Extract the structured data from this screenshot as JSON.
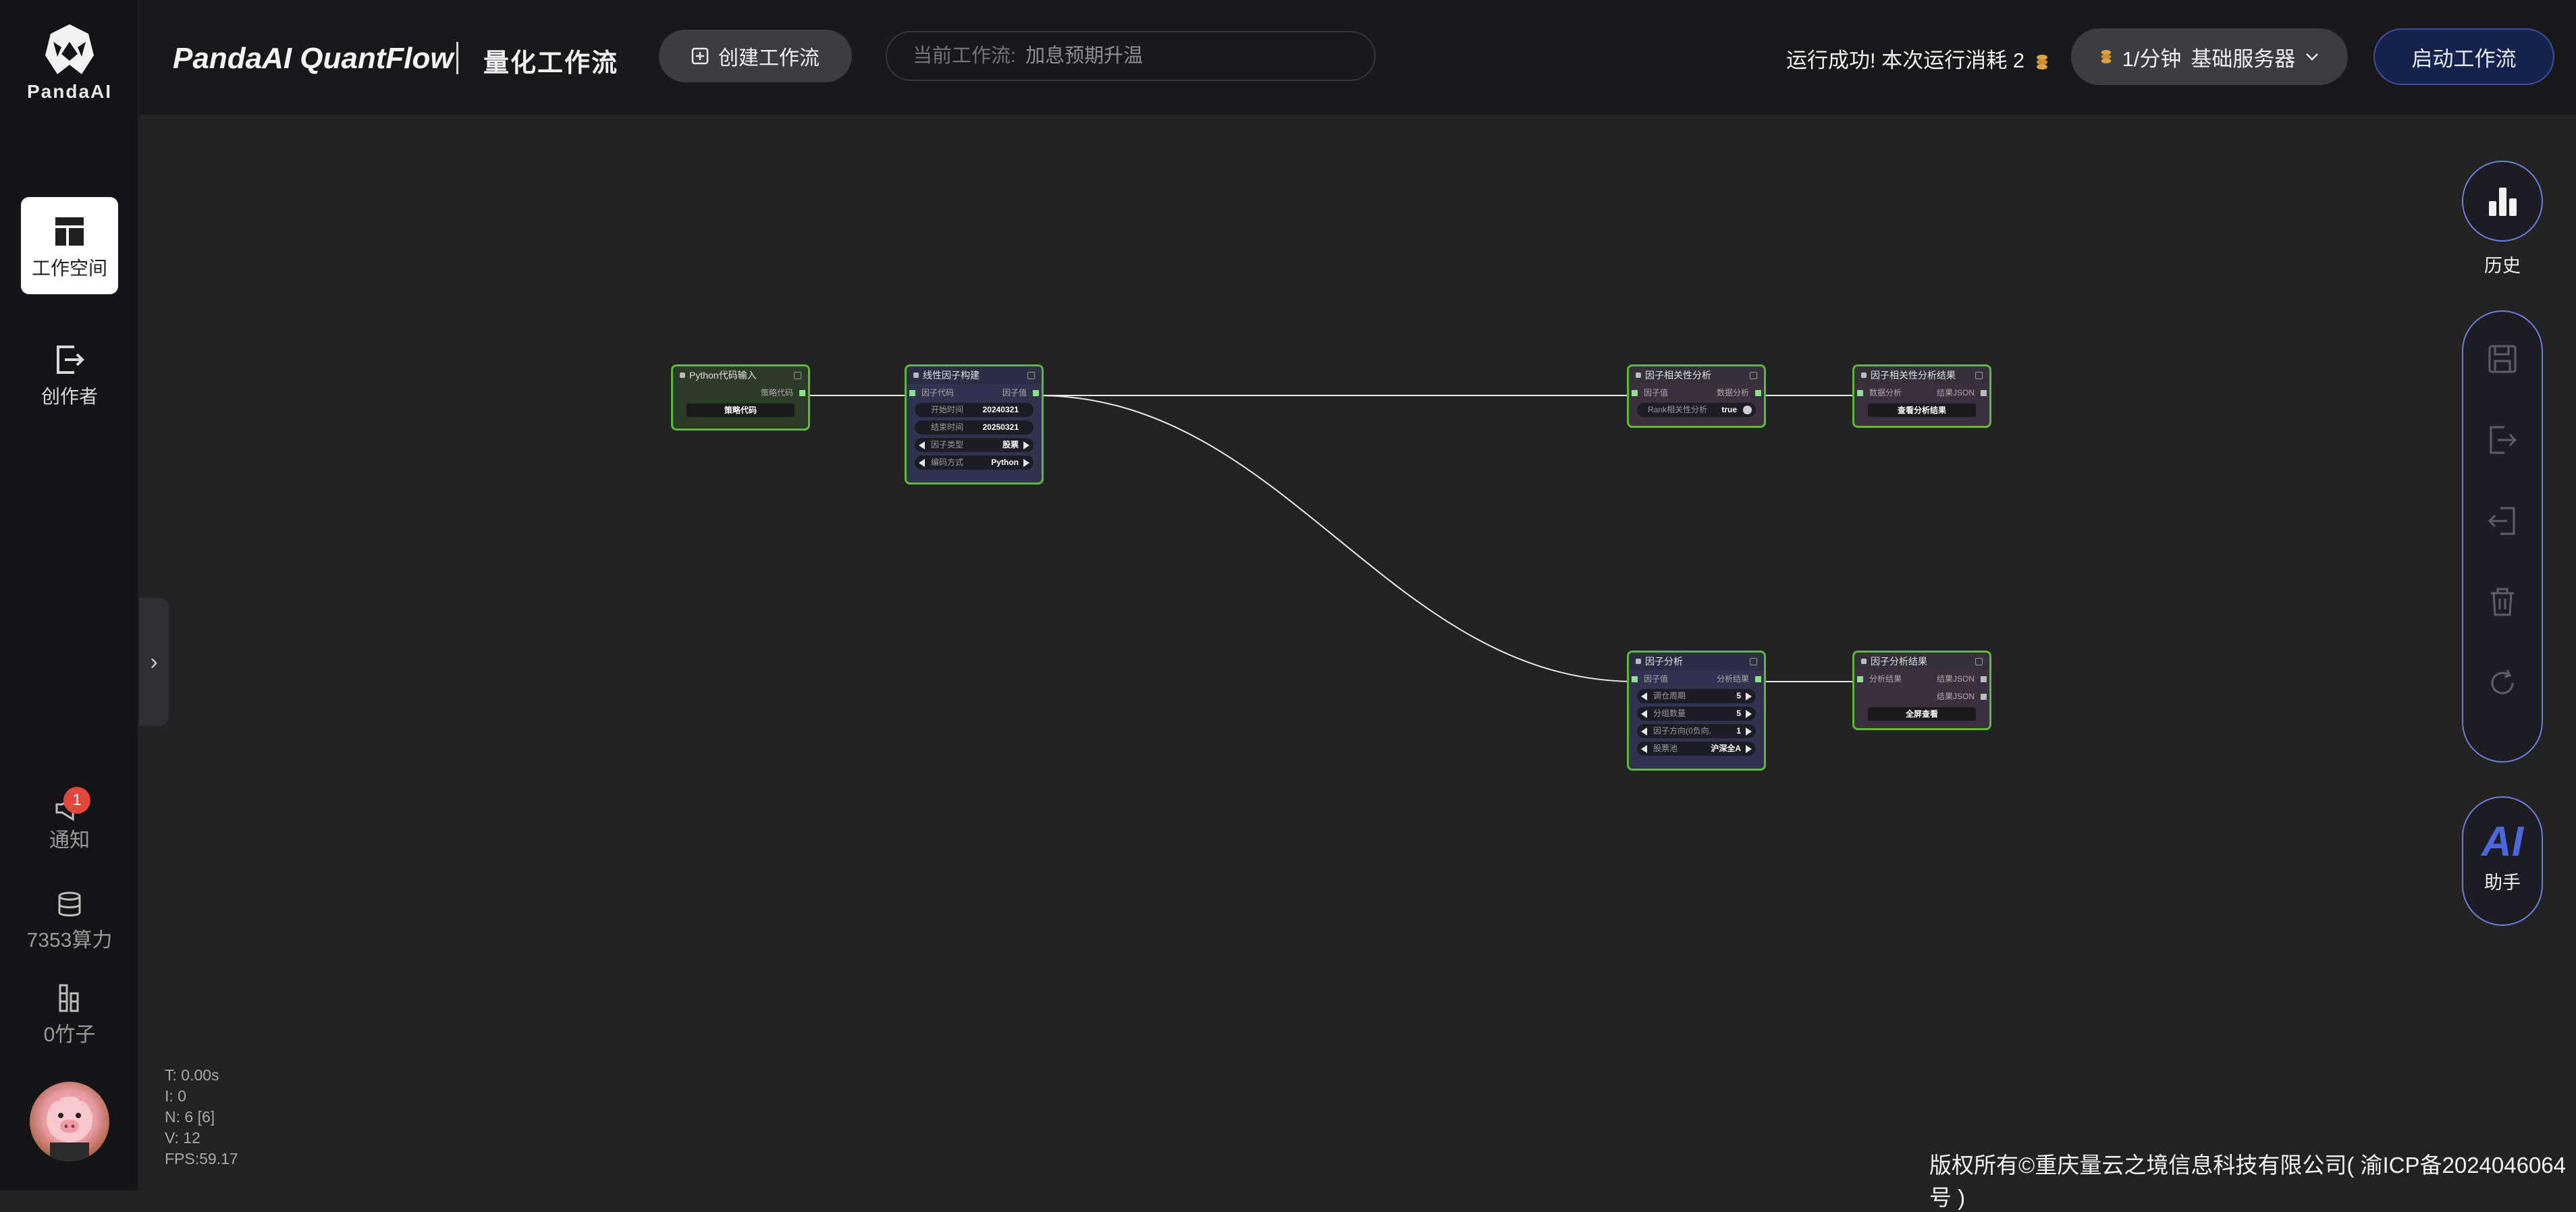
{
  "app": {
    "logo_text": "PandaAI",
    "brand": "PandaAI QuantFlow",
    "subtitle": "量化工作流"
  },
  "header": {
    "create_button": "创建工作流",
    "current_flow_label": "当前工作流:",
    "current_flow_value": "加息预期升温",
    "run_status": "运行成功!  本次运行消耗 2",
    "speed": "1/分钟",
    "server": "基础服务器",
    "start_button": "启动工作流"
  },
  "sidebar": {
    "workspace": "工作空间",
    "creator": "创作者",
    "notify": "通知",
    "notify_count": "1",
    "compute": "7353算力",
    "bamboo": "0竹子"
  },
  "stats": {
    "t": "T: 0.00s",
    "i": "I: 0",
    "n": "N: 6 [6]",
    "v": "V: 12",
    "fps": "FPS:59.17"
  },
  "copyright": "版权所有©重庆量云之境信息科技有限公司( 渝ICP备2024046064号 )",
  "right_panel": {
    "history": "历史",
    "ai_text": "AI",
    "assistant": "助手"
  },
  "nodes": {
    "python_input": {
      "title": "Python代码输入",
      "out_label": "策略代码",
      "button": "策略代码"
    },
    "factor_build": {
      "title": "线性因子构建",
      "in_label": "因子代码",
      "out_label": "因子值",
      "start_label": "开始时间",
      "start_value": "20240321",
      "end_label": "结束时间",
      "end_value": "20250321",
      "type_label": "因子类型",
      "type_value": "股票",
      "method_label": "编码方式",
      "method_value": "Python"
    },
    "corr_analysis": {
      "title": "因子相关性分析",
      "in_label": "因子值",
      "out_label": "数据分析",
      "toggle_label": "Rank相关性分析",
      "toggle_value": "true"
    },
    "corr_result": {
      "title": "因子相关性分析结果",
      "in_label": "数据分析",
      "out_label": "结果JSON",
      "button": "查看分析结果"
    },
    "factor_analysis": {
      "title": "因子分析",
      "in_label": "因子值",
      "out_label": "分析结果",
      "f1_label": "调仓周期",
      "f1_value": "5",
      "f2_label": "分组数量",
      "f2_value": "5",
      "f3_label": "因子方向(0负向,",
      "f3_value": "1",
      "f4_label": "股票池",
      "f4_value": "沪深全A"
    },
    "factor_result": {
      "title": "因子分析结果",
      "in_label": "分析结果",
      "out_label1": "结果JSON",
      "out_label2": "结果JSON",
      "button": "全屏查看"
    }
  }
}
